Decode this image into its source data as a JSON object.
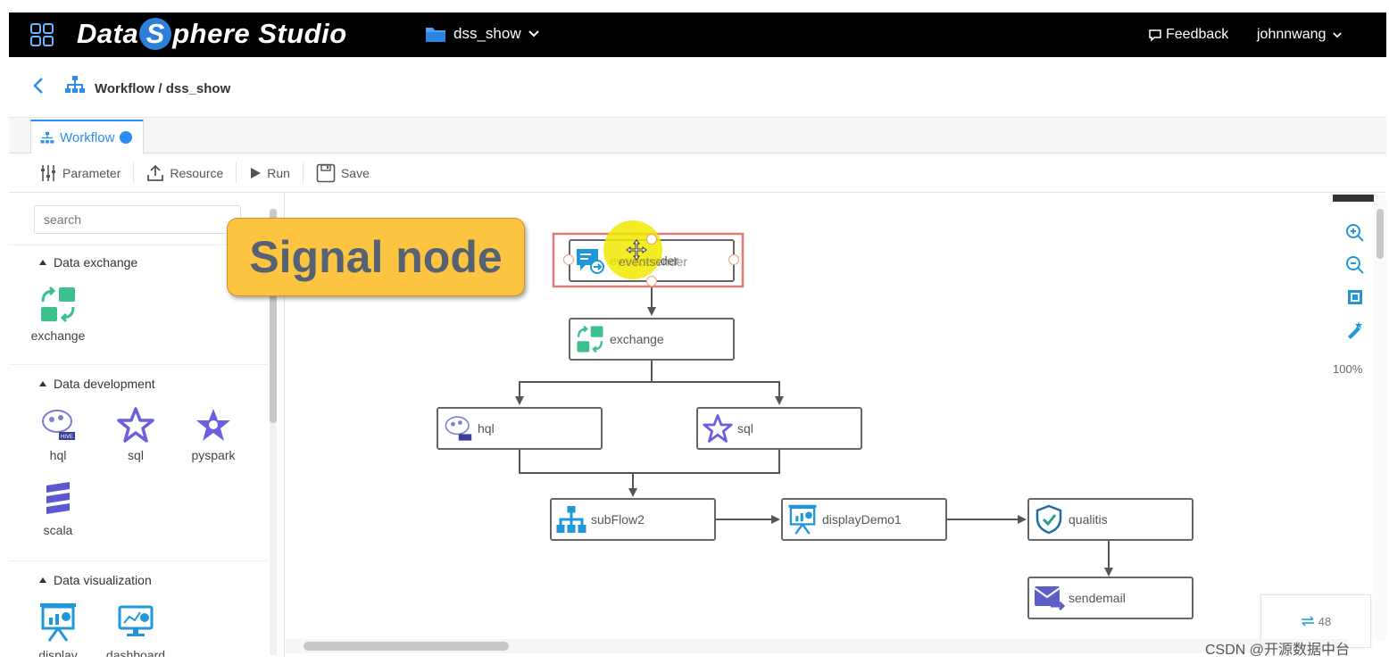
{
  "header": {
    "brand_part1": "Data",
    "brand_letter": "S",
    "brand_part2": "phere Studio",
    "project": "dss_show",
    "feedback": "Feedback",
    "user": "johnnwang"
  },
  "breadcrumb": {
    "text": "Workflow / dss_show"
  },
  "tabs": [
    {
      "label": "Workflow"
    }
  ],
  "toolbar": {
    "parameter": "Parameter",
    "resource": "Resource",
    "run": "Run",
    "save": "Save"
  },
  "sidebar": {
    "search_placeholder": "search",
    "sections": [
      {
        "title": "Data exchange",
        "items": [
          "exchange"
        ]
      },
      {
        "title": "Data development",
        "items": [
          "hql",
          "sql",
          "pyspark",
          "scala"
        ]
      },
      {
        "title": "Data visualization",
        "items": [
          "display",
          "dashboard"
        ]
      }
    ]
  },
  "callout": {
    "text": "Signal node"
  },
  "nodes": {
    "eventsender": "eventsender",
    "exchange": "exchange",
    "hql": "hql",
    "sql": "sql",
    "subflow": "subFlow2",
    "display": "displayDemo1",
    "qualitis": "qualitis",
    "sendemail": "sendemail"
  },
  "zoom": "100%",
  "minimap": {
    "count": "48"
  },
  "watermark": "CSDN @开源数据中台",
  "colors": {
    "accent": "#2d8cf0",
    "callout": "#fdc441",
    "highlight": "#f2e900",
    "selection": "#e07a74"
  }
}
